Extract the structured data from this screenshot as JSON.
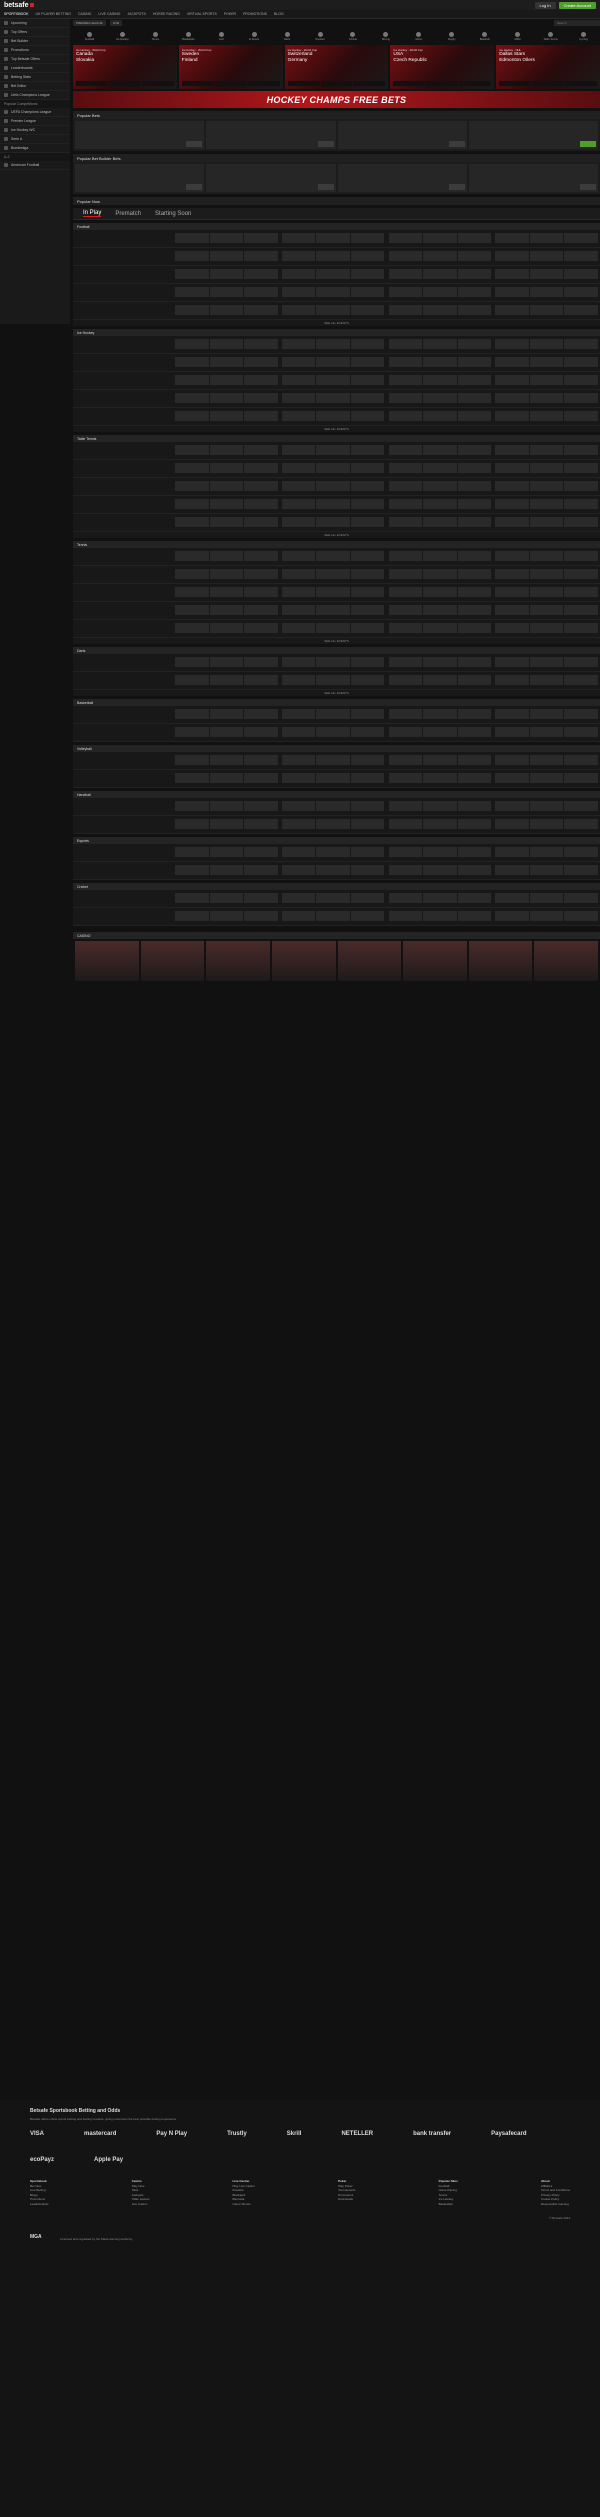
{
  "header": {
    "brand": "betsafe",
    "login": "Log In",
    "join": "Create Account"
  },
  "nav": [
    "SPORTSBOOK",
    "UK PLAYER BETTING",
    "CASINO",
    "LIVE CASINO",
    "JACKPOTS",
    "HORSE RACING",
    "VIRTUAL SPORTS",
    "POKER",
    "PROMOTIONS",
    "BLOG"
  ],
  "sidebar": {
    "items": [
      "Upcoming",
      "Top Offers",
      "Bet Builder",
      "Promotions",
      "Top Betsafe Offers",
      "Leaderboards",
      "Betting Stats",
      "Bet Editor",
      "Uefa Champions League"
    ],
    "heading_competitions": "Popular Competitions",
    "competitions": [
      "UEFA Champions League",
      "Premier League",
      "Ice Hockey WC",
      "Serie A",
      "Bundesliga"
    ],
    "heading_az": "A-Z",
    "az": [
      "American Football"
    ]
  },
  "subnav": {
    "chips": [
      "PREMIER LEAGUE",
      "LIVE"
    ],
    "search_placeholder": "Search"
  },
  "sports": [
    "Football",
    "Ice Hockey",
    "Tennis",
    "Basketball",
    "Golf",
    "E-Sports",
    "Darts",
    "Snooker",
    "Cricket",
    "Boxing",
    "Motor",
    "Rugby",
    "Baseball",
    "MMA",
    "Table Tennis",
    "Cycling"
  ],
  "hero": [
    {
      "comp": "Ice Hockey - World Cup",
      "team1": "Canada",
      "team2": "Slovakia"
    },
    {
      "comp": "Ice Hockey - World Cup",
      "team1": "Sweden",
      "team2": "Finland"
    },
    {
      "comp": "Ice Hockey - World Cup",
      "team1": "Switzerland",
      "team2": "Germany"
    },
    {
      "comp": "Ice Hockey - World Cup",
      "team1": "USA",
      "team2": "Czech Republic"
    },
    {
      "comp": "Ice Hockey - NHL",
      "team1": "Dallas Stars",
      "team2": "Edmonton Oilers"
    }
  ],
  "banner": "HOCKEY CHAMPS FREE BETS",
  "sections": {
    "popular_bets": "Popular Bets",
    "popular_builder": "Popular Bet Builder Bets",
    "popular_now": "Popular Now"
  },
  "tabs": [
    "In Play",
    "Prematch",
    "Starting Soon"
  ],
  "sport_blocks": [
    "Football",
    "Ice Hockey",
    "Table Tennis",
    "Tennis",
    "Darts",
    "Basketball",
    "Volleyball",
    "Handball",
    "Esports",
    "Cricket"
  ],
  "show_more": "SEE ALL EVENTS",
  "casino_heading": "CASINO",
  "footer": {
    "title": "Betsafe Sportsbook Betting and Odds",
    "intro": "Betsafe offers online sports betting and betting markets, giving customers the best possible betting experience.",
    "payments": [
      "VISA",
      "mastercard",
      "Pay N Play",
      "Trustly",
      "Skrill",
      "NETELLER",
      "bank transfer",
      "Paysafecard",
      "ecoPayz",
      "Apple Pay"
    ],
    "columns": [
      {
        "title": "Sportsbook",
        "items": [
          "Bet Now",
          "Live Betting",
          "Bingo",
          "Promotions",
          "Leaderboards"
        ]
      },
      {
        "title": "Casino",
        "items": [
          "Play Now",
          "Slots",
          "Jackpots",
          "Table Games",
          "Live Casino"
        ]
      },
      {
        "title": "Live Casino",
        "items": [
          "Play Live Casino",
          "Roulette",
          "Blackjack",
          "Baccarat",
          "Game Shows"
        ]
      },
      {
        "title": "Poker",
        "items": [
          "Play Poker",
          "Tournaments",
          "Promotions",
          "Downloads"
        ]
      },
      {
        "title": "Popular Sites",
        "items": [
          "Football",
          "Horse Racing",
          "Tennis",
          "Ice Hockey",
          "Basketball"
        ]
      },
      {
        "title": "About",
        "items": [
          "Affiliates",
          "Terms and Conditions",
          "Privacy Policy",
          "Cookie Policy",
          "Responsible Gaming"
        ]
      }
    ],
    "copyright": "© Betsafe 2024",
    "licence_badge": "MGA",
    "licence_text": "Licensed and regulated by the Malta Gaming Authority."
  }
}
